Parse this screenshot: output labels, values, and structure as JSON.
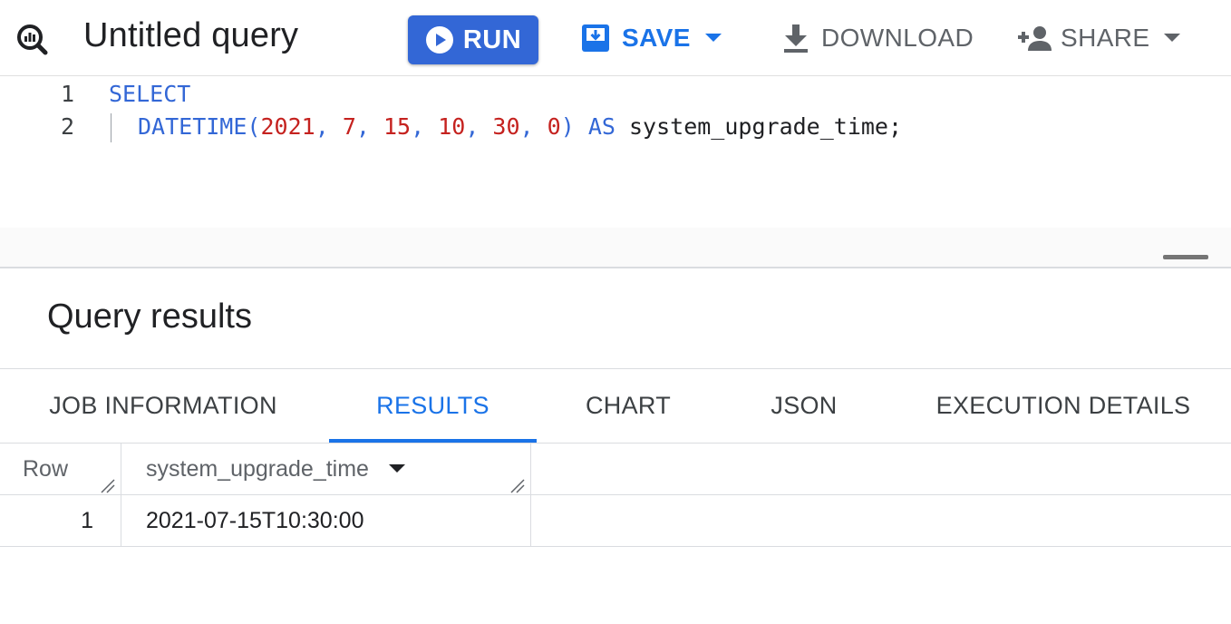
{
  "toolbar": {
    "title": "Untitled query",
    "run_label": "RUN",
    "save_label": "SAVE",
    "download_label": "DOWNLOAD",
    "share_label": "SHARE",
    "accent_color": "#3367d6",
    "icons": [
      "query-icon",
      "play-icon",
      "save-icon",
      "download-icon",
      "person-add-icon",
      "caret-down-icon"
    ]
  },
  "editor": {
    "line_numbers": [
      "1",
      "2"
    ],
    "line1": {
      "keyword": "SELECT"
    },
    "line2": {
      "fn": "DATETIME",
      "open": "(",
      "args": [
        "2021",
        "7",
        "15",
        "10",
        "30",
        "0"
      ],
      "sep": ", ",
      "close": ")",
      "as": "AS",
      "alias": "system_upgrade_time",
      "terminator": ";"
    }
  },
  "results": {
    "title": "Query results",
    "tabs": [
      "JOB INFORMATION",
      "RESULTS",
      "CHART",
      "JSON",
      "EXECUTION DETAILS"
    ],
    "active_tab": "RESULTS",
    "table": {
      "columns": [
        "Row",
        "system_upgrade_time"
      ],
      "rows": [
        {
          "row": "1",
          "system_upgrade_time": "2021-07-15T10:30:00"
        }
      ]
    }
  }
}
